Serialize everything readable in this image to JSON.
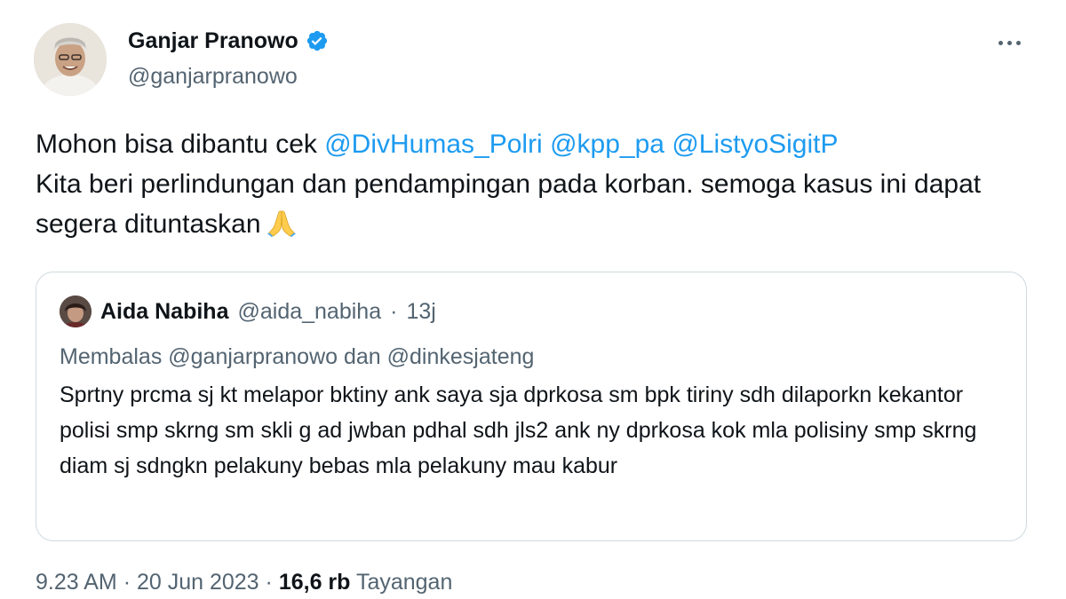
{
  "author": {
    "display_name": "Ganjar Pranowo",
    "handle": "@ganjarpranowo",
    "verified": true,
    "verified_color": "#1d9bf0"
  },
  "tweet": {
    "line1_text": "Mohon bisa dibantu cek ",
    "mentions": [
      "@DivHumas_Polri",
      "@kpp_pa",
      "@ListyoSigitP"
    ],
    "line2_text": "Kita beri perlindungan dan pendampingan pada korban. semoga kasus ini dapat segera dituntaskan",
    "emoji": "folded-hands"
  },
  "quoted_tweet": {
    "display_name": "Aida Nabiha",
    "handle": "@aida_nabiha",
    "separator": "·",
    "time": "13j",
    "reply_to": "Membalas @ganjarpranowo dan @dinkesjateng",
    "text": "Sprtny prcma sj kt melapor bktiny ank saya sja dprkosa sm bpk tiriny sdh dilaporkn kekantor polisi smp skrng sm skli g ad jwban pdhal sdh jls2 ank ny dprkosa kok mla polisiny smp skrng diam sj sdngkn pelakuny bebas mla pelakuny mau kabur"
  },
  "meta": {
    "time": "9.23 AM",
    "separator": "·",
    "date": "20 Jun 2023",
    "views_count": "16,6 rb",
    "views_label": "Tayangan"
  },
  "colors": {
    "text": "#0f1419",
    "secondary": "#536471",
    "link": "#1d9bf0",
    "border": "#cfd9de"
  }
}
